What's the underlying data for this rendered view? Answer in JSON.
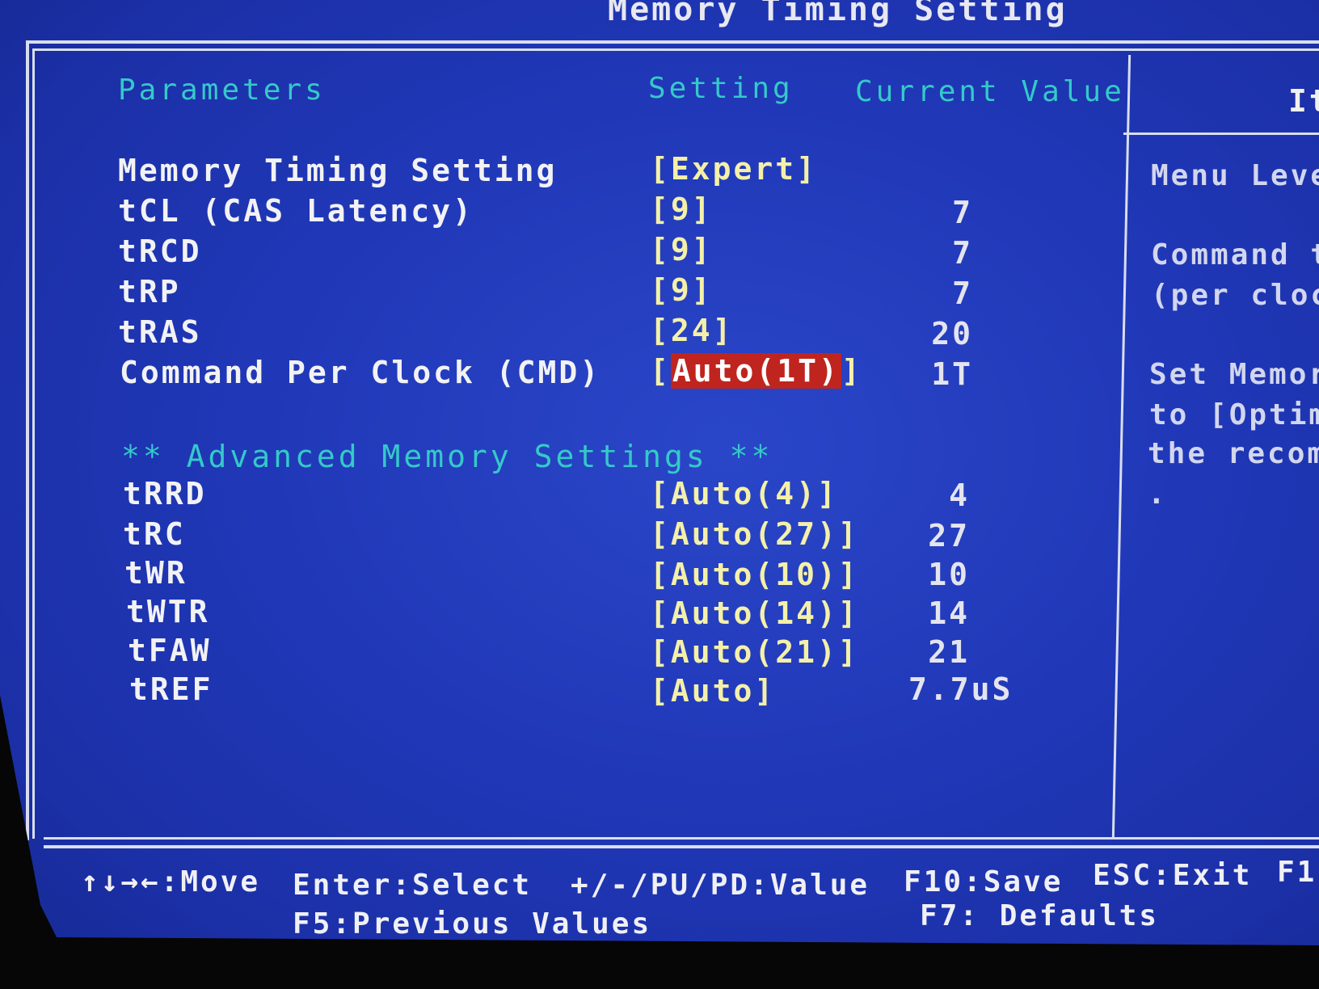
{
  "window_title": "Memory Timing Setting",
  "columns": {
    "parameters": "Parameters",
    "setting": "Setting",
    "current_value": "Current Value"
  },
  "rows": [
    {
      "label": "Memory Timing Setting",
      "setting": "[Expert]",
      "current": ""
    },
    {
      "label": "tCL (CAS Latency)",
      "setting": "[9]",
      "current": "7"
    },
    {
      "label": "tRCD",
      "setting": "[9]",
      "current": "7"
    },
    {
      "label": "tRP",
      "setting": "[9]",
      "current": "7"
    },
    {
      "label": "tRAS",
      "setting": "[24]",
      "current": "20"
    },
    {
      "label": "Command Per Clock (CMD)",
      "setting_open": "[",
      "setting_value": "Auto(1T)",
      "setting_close": "]",
      "current": "1T",
      "selected": true
    }
  ],
  "advanced_heading": "** Advanced Memory Settings **",
  "advanced_rows": [
    {
      "label": "tRRD",
      "setting": "[Auto(4)]",
      "current": "4"
    },
    {
      "label": "tRC",
      "setting": "[Auto(27)]",
      "current": "27"
    },
    {
      "label": "tWR",
      "setting": "[Auto(10)]",
      "current": "10"
    },
    {
      "label": "tWTR",
      "setting": "[Auto(14)]",
      "current": "14"
    },
    {
      "label": "tFAW",
      "setting": "[Auto(21)]",
      "current": "21"
    },
    {
      "label": "tREF",
      "setting": "[Auto]",
      "current": "7.7uS"
    }
  ],
  "help_panel": {
    "title": "It",
    "lines": [
      "Menu Leve",
      "Command t",
      "(per cloc",
      "Set Memor",
      "to [Optim",
      "the recomm",
      "."
    ]
  },
  "footer": {
    "move": "↑↓→←:Move",
    "select": "Enter:Select",
    "value": "+/-/PU/PD:Value",
    "save": "F10:Save",
    "exit": "ESC:Exit",
    "f1": "F1",
    "previous": "F5:Previous Values",
    "defaults": "F7: Defaults"
  },
  "colors": {
    "background": "#2038b8",
    "header_text": "#35c9c9",
    "setting_text": "#f4f0a8",
    "highlight": "#c0241e"
  }
}
